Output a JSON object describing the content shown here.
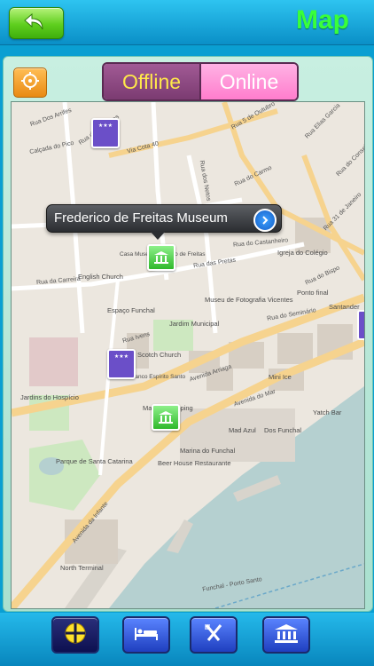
{
  "header": {
    "title": "Map",
    "back_icon": "back-arrow-icon"
  },
  "toolbar": {
    "locate_icon": "target-icon"
  },
  "segmented": {
    "offline_label": "Offline",
    "online_label": "Online",
    "selected": "Offline"
  },
  "callout": {
    "title": "Frederico de Freitas Museum",
    "disclosure_icon": "info-disclosure-icon"
  },
  "map": {
    "streets": [
      "Rua Dos Arrifes",
      "Calçada do Pico",
      "Rua dos Aranhas",
      "Via Cota 40",
      "Rua 5 de Outubro",
      "Rua Elias Garcia",
      "Rua do Carmo",
      "Rua do Conselho",
      "Rua dos Netos",
      "Rua do Castanheiro",
      "Rua das Pretas",
      "Rua da Carreira",
      "Avenida Arriaga",
      "Avenida do Mar",
      "Rua 31 de Janeiro",
      "Rua do Bispo",
      "Rua do Seminário",
      "Avenida da Infante",
      "Rua Ivens",
      "Funchal - Porto Santo"
    ],
    "places": [
      "English Church",
      "Espaço Funchal",
      "Casa Museu Frederico de Freitas",
      "Scotch Church",
      "Jardim Municipal",
      "Museu de Fotografia Vicentes",
      "Igreja do Colégio",
      "Ponto final",
      "Santander",
      "Jardins do Hospício",
      "Parque de Santa Catarina",
      "Marina Shopping",
      "Beer House Restaurante",
      "Marina do Funchal",
      "Mini Ice",
      "Mad Azul",
      "Dos Funchal",
      "Yatch Bar",
      "North Terminal",
      "Banco Espírito Santo"
    ]
  },
  "bottom_tools": [
    {
      "name": "compass",
      "icon": "compass-icon"
    },
    {
      "name": "hotel",
      "icon": "bed-icon"
    },
    {
      "name": "food",
      "icon": "fork-knife-icon"
    },
    {
      "name": "museum",
      "icon": "museum-icon"
    }
  ]
}
